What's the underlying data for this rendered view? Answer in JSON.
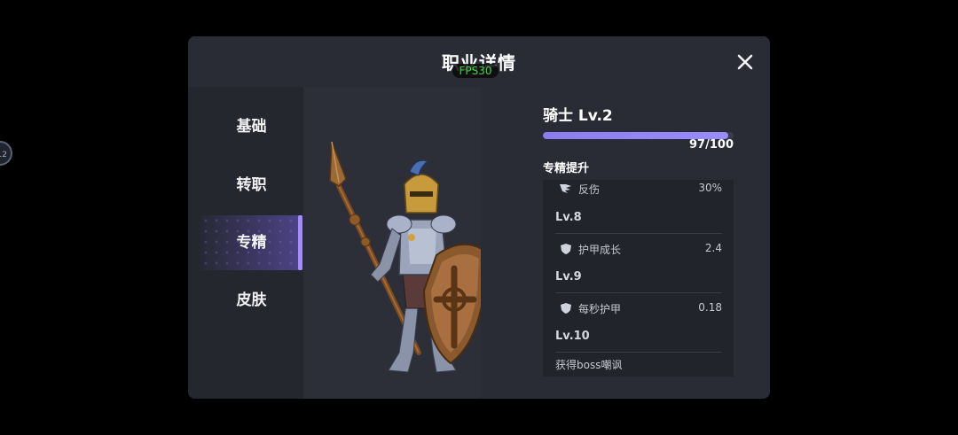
{
  "edge_button": {
    "label": "12"
  },
  "dialog": {
    "title": "职业详情",
    "fps": "FPS30"
  },
  "sidebar": {
    "tabs": [
      {
        "label": "基础",
        "active": false
      },
      {
        "label": "转职",
        "active": false
      },
      {
        "label": "专精",
        "active": true
      },
      {
        "label": "皮肤",
        "active": false
      }
    ]
  },
  "character": {
    "name": "骑士 Lv.2",
    "xp_text": "97/100",
    "xp_progress": 0.97
  },
  "specialization": {
    "title": "专精提升",
    "entries": [
      {
        "icon": "claw-icon",
        "label": "反伤",
        "value": "30%"
      },
      {
        "level": "Lv.8"
      },
      {
        "icon": "shield-icon",
        "label": "护甲成长",
        "value": "2.4"
      },
      {
        "level": "Lv.9"
      },
      {
        "icon": "shield-icon",
        "label": "每秒护甲",
        "value": "0.18"
      },
      {
        "level": "Lv.10"
      },
      {
        "text": "获得boss嘲讽"
      }
    ]
  },
  "colors": {
    "accent": "#9a8bff",
    "panel": "#2a2c35",
    "fps_green": "#3fd23f"
  }
}
